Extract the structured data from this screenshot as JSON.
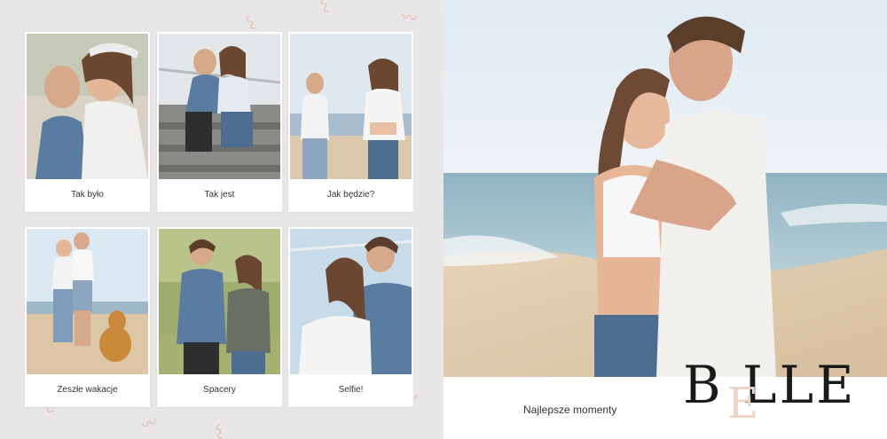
{
  "left_page": {
    "polaroids": [
      {
        "caption": "Tak było"
      },
      {
        "caption": "Tak jest"
      },
      {
        "caption": "Jak będzie?"
      },
      {
        "caption": "Zeszłe wakacje"
      },
      {
        "caption": "Spacery"
      },
      {
        "caption": "Selfie!"
      }
    ],
    "squiggle_glyph": "〰",
    "squiggle_color": "#e2b9a6"
  },
  "right_page": {
    "subtitle": "Najlepsze momenty",
    "logo": {
      "text": "B LLE",
      "overlay_letter": "E",
      "overlay_color": "#ecd3c6"
    }
  }
}
